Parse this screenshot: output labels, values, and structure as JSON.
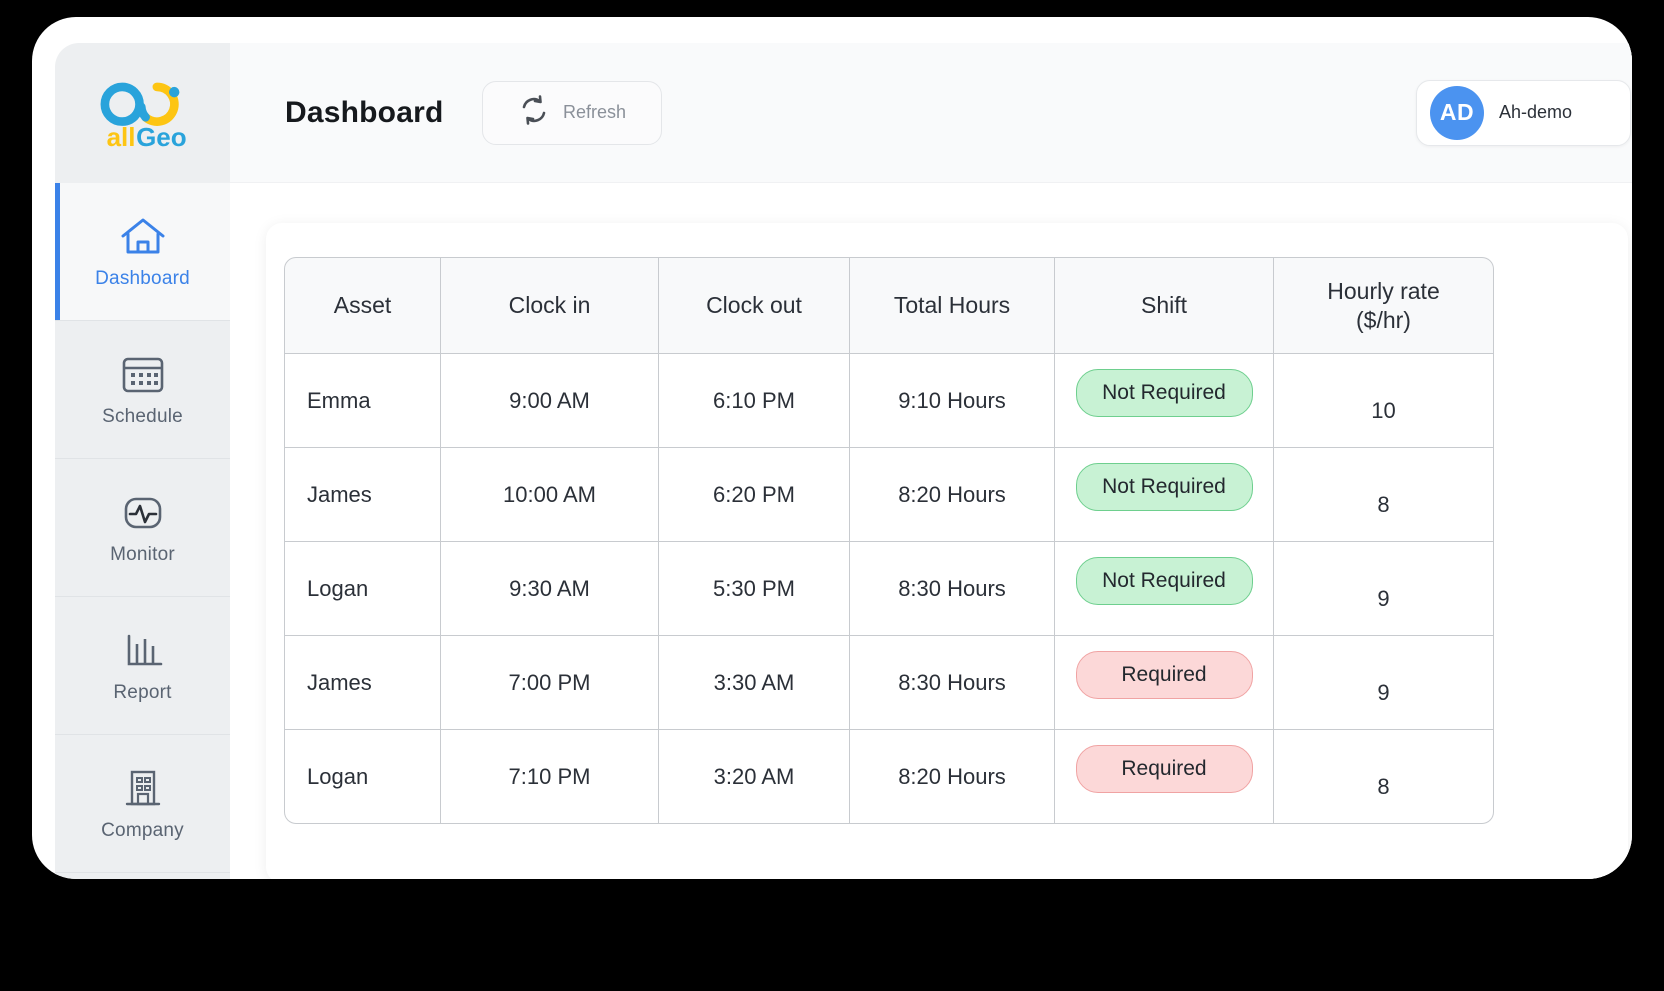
{
  "brand": {
    "name": "allGeo",
    "text_part1": "all",
    "text_part2": "Geo"
  },
  "sidebar": {
    "items": [
      {
        "label": "Dashboard",
        "icon": "home-icon",
        "active": true
      },
      {
        "label": "Schedule",
        "icon": "calendar-icon",
        "active": false
      },
      {
        "label": "Monitor",
        "icon": "activity-pulse-icon",
        "active": false
      },
      {
        "label": "Report",
        "icon": "bar-chart-icon",
        "active": false
      },
      {
        "label": "Company",
        "icon": "building-icon",
        "active": false
      }
    ]
  },
  "header": {
    "title": "Dashboard",
    "refresh_label": "Refresh",
    "refresh_icon": "refresh-sync-icon",
    "user": {
      "initials": "AD",
      "name": "Ah-demo"
    }
  },
  "table": {
    "columns": [
      "Asset",
      "Clock in",
      "Clock out",
      "Total Hours",
      "Shift",
      "Hourly rate\n($/hr)"
    ],
    "column_rate_line1": "Hourly rate",
    "column_rate_line2": "($/hr)",
    "rows": [
      {
        "asset": "Emma",
        "clock_in": "9:00 AM",
        "clock_out": "6:10 PM",
        "total_hours": "9:10 Hours",
        "shift": "Not Required",
        "shift_state": "green",
        "rate": "10"
      },
      {
        "asset": "James",
        "clock_in": "10:00 AM",
        "clock_out": "6:20 PM",
        "total_hours": "8:20 Hours",
        "shift": "Not Required",
        "shift_state": "green",
        "rate": "8"
      },
      {
        "asset": "Logan",
        "clock_in": "9:30 AM",
        "clock_out": "5:30 PM",
        "total_hours": "8:30 Hours",
        "shift": "Not Required",
        "shift_state": "green",
        "rate": "9"
      },
      {
        "asset": "James",
        "clock_in": "7:00 PM",
        "clock_out": "3:30 AM",
        "total_hours": "8:30 Hours",
        "shift": "Required",
        "shift_state": "pink",
        "rate": "9"
      },
      {
        "asset": "Logan",
        "clock_in": "7:10 PM",
        "clock_out": "3:20 AM",
        "total_hours": "8:20 Hours",
        "shift": "Required",
        "shift_state": "pink",
        "rate": "8"
      }
    ]
  },
  "colors": {
    "accent_blue": "#3b82e8",
    "avatar_blue": "#4b93f0",
    "brand_yellow": "#fdc513",
    "brand_blue": "#29a3db",
    "badge_green_bg": "#c8f2d4",
    "badge_green_border": "#6ecf8e",
    "badge_pink_bg": "#fcd8d8",
    "badge_pink_border": "#f0a3a3",
    "sidebar_bg": "#edeff1",
    "topbar_bg": "#f9fafb"
  }
}
